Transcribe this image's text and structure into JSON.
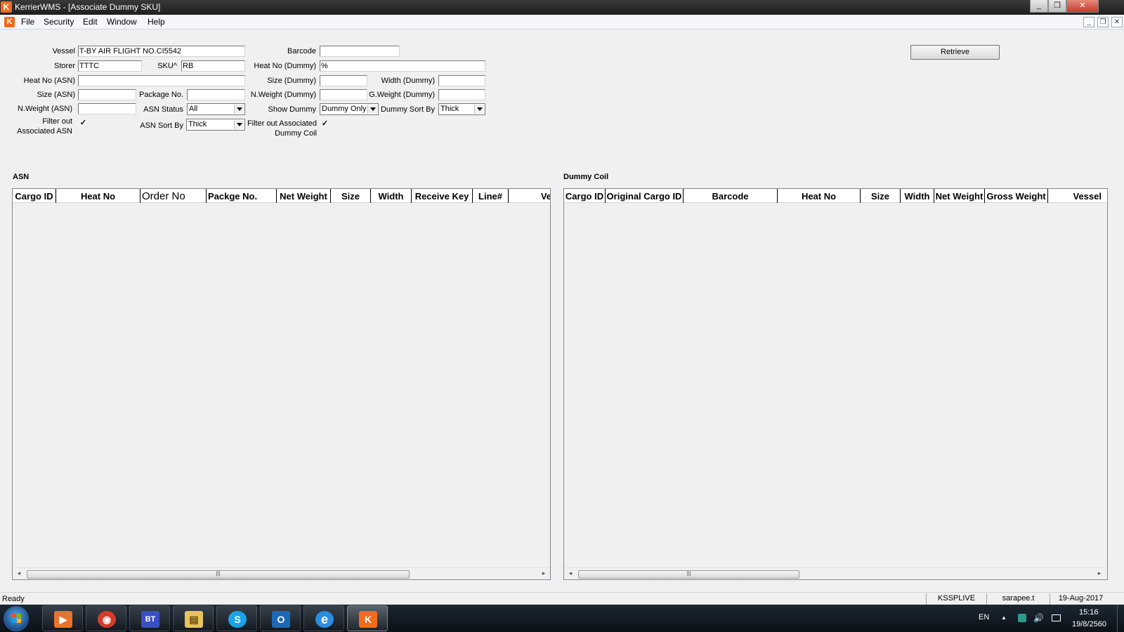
{
  "window": {
    "title": "KerrierWMS - [Associate Dummy SKU]",
    "minimize_glyph": "_",
    "maximize_glyph": "❐",
    "close_glyph": "✕",
    "app_icon_letter": "K"
  },
  "menu": {
    "items": [
      "File",
      "Security",
      "Edit",
      "Window",
      "Help"
    ],
    "mdi_minimize": "_",
    "mdi_restore": "❐",
    "mdi_close": "✕"
  },
  "form": {
    "vessel": {
      "label": "Vessel",
      "value": "T-BY AIR FLIGHT NO.CI5542"
    },
    "barcode": {
      "label": "Barcode",
      "value": ""
    },
    "storer": {
      "label": "Storer",
      "value": "TTTC"
    },
    "sku": {
      "label": "SKU^",
      "value": "RB"
    },
    "heat_no_dummy": {
      "label": "Heat No (Dummy)",
      "value": "%"
    },
    "heat_no_asn": {
      "label": "Heat No (ASN)",
      "value": ""
    },
    "size_dummy": {
      "label": "Size (Dummy)",
      "value": ""
    },
    "width_dummy": {
      "label": "Width (Dummy)",
      "value": ""
    },
    "size_asn": {
      "label": "Size (ASN)",
      "value": ""
    },
    "package_no": {
      "label": "Package No.",
      "value": ""
    },
    "nweight_dummy": {
      "label": "N.Weight (Dummy)",
      "value": ""
    },
    "gweight_dummy": {
      "label": "G.Weight (Dummy)",
      "value": ""
    },
    "nweight_asn": {
      "label": "N.Weight (ASN)",
      "value": ""
    },
    "asn_status": {
      "label": "ASN Status",
      "value": "All"
    },
    "show_dummy": {
      "label": "Show Dummy",
      "value": "Dummy Only"
    },
    "dummy_sort_by": {
      "label": "Dummy Sort By",
      "value": "Thick"
    },
    "filter_asn": {
      "label_line1": "Filter out",
      "label_line2": "Associated ASN",
      "checked": true,
      "mark": "✓"
    },
    "asn_sort_by": {
      "label": "ASN Sort By",
      "value": "Thick"
    },
    "filter_dummy": {
      "label_line1": "Filter out Associated",
      "label_line2": "Dummy Coil",
      "checked": true,
      "mark": "✓"
    },
    "retrieve_button": "Retrieve"
  },
  "asn_grid": {
    "title": "ASN",
    "columns": [
      "Cargo ID",
      "Heat No",
      "Order No",
      "Packge No.",
      "Net Weight",
      "Size",
      "Width",
      "Receive Key",
      "Line#",
      "Ve"
    ],
    "rows": []
  },
  "dummy_grid": {
    "title": "Dummy Coil",
    "columns": [
      "Cargo ID",
      "Original Cargo ID",
      "Barcode",
      "Heat No",
      "Size",
      "Width",
      "Net Weight",
      "Gross Weight",
      "Vessel"
    ],
    "rows": []
  },
  "scroll": {
    "left_arrow": "◂",
    "right_arrow": "▸",
    "grip": "|||"
  },
  "status": {
    "text": "Ready",
    "server": "KSSPLIVE",
    "user": "sarapee.t",
    "date": "19-Aug-2017"
  },
  "taskbar": {
    "apps": [
      "media-player",
      "chrome",
      "bt-app",
      "file-explorer",
      "skype",
      "outlook",
      "internet-explorer",
      "kerrier-wms"
    ],
    "app_glyphs": [
      "▶",
      "◉",
      "BT",
      "▤",
      "S",
      "O",
      "e",
      "K"
    ],
    "language": "EN",
    "tray_up_arrow": "▲",
    "time": "15:16",
    "date": "19/8/2560"
  },
  "colors": {
    "accent_orange": "#f26b1d",
    "window_bg": "#f0f0f0"
  }
}
